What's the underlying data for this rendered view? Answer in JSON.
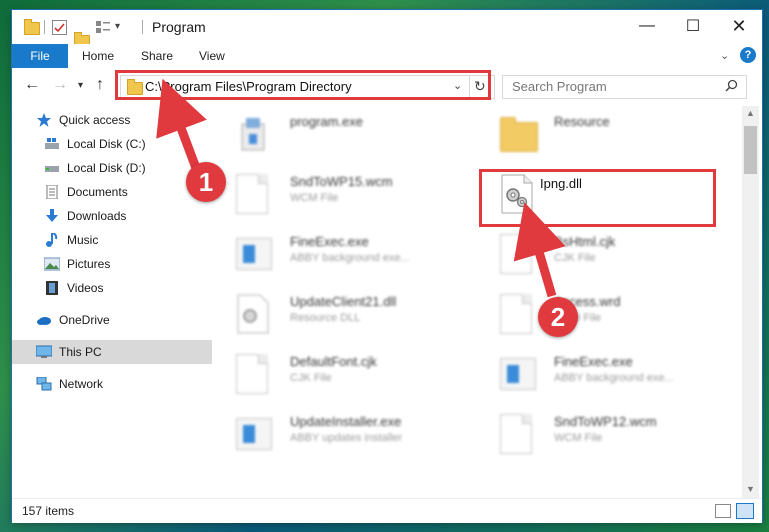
{
  "window": {
    "title": "Program"
  },
  "ribbon": {
    "tabs": [
      "File",
      "Home",
      "Share",
      "View"
    ]
  },
  "address": {
    "path": "C:\\Program Files\\Program Directory"
  },
  "search": {
    "placeholder": "Search Program"
  },
  "nav": {
    "items": [
      {
        "label": "Quick access",
        "icon": "star-icon"
      },
      {
        "label": "Local Disk (C:)",
        "icon": "drive-icon"
      },
      {
        "label": "Local Disk (D:)",
        "icon": "drive-icon"
      },
      {
        "label": "Documents",
        "icon": "documents-icon"
      },
      {
        "label": "Downloads",
        "icon": "download-arrow-icon"
      },
      {
        "label": "Music",
        "icon": "music-note-icon"
      },
      {
        "label": "Pictures",
        "icon": "pictures-icon"
      },
      {
        "label": "Videos",
        "icon": "film-icon"
      },
      {
        "label": "OneDrive",
        "icon": "cloud-icon"
      },
      {
        "label": "This PC",
        "icon": "monitor-icon"
      },
      {
        "label": "Network",
        "icon": "network-icon"
      }
    ]
  },
  "files": [
    {
      "name": "program.exe",
      "type": "",
      "icon": "installer-icon"
    },
    {
      "name": "Resource",
      "type": "",
      "icon": "folder-icon"
    },
    {
      "name": "SndToWP15.wcm",
      "type": "WCM File",
      "icon": "document-icon"
    },
    {
      "name": "Ipng.dll",
      "type": "",
      "icon": "gear-dll-icon"
    },
    {
      "name": "FineExec.exe",
      "type": "ABBY background exe...",
      "icon": "app-icon"
    },
    {
      "name": "BsHtml.cjk",
      "type": "CJK File",
      "icon": "document-icon"
    },
    {
      "name": "UpdateClient21.dll",
      "type": "Resource DLL",
      "icon": "gear-dll-icon"
    },
    {
      "name": "Access.wrd",
      "type": "WRD File",
      "icon": "document-icon"
    },
    {
      "name": "DefaultFont.cjk",
      "type": "CJK File",
      "icon": "document-icon"
    },
    {
      "name": "FineExec.exe",
      "type": "ABBY background exe...",
      "icon": "app-icon"
    },
    {
      "name": "UpdateInstaller.exe",
      "type": "ABBY updates installer",
      "icon": "app-icon"
    },
    {
      "name": "SndToWP12.wcm",
      "type": "WCM File",
      "icon": "document-icon"
    }
  ],
  "status": {
    "count": "157 items"
  },
  "annotations": {
    "step1": "1",
    "step2": "2"
  },
  "colors": {
    "accent": "#1979ca",
    "highlight": "#e0393e"
  }
}
